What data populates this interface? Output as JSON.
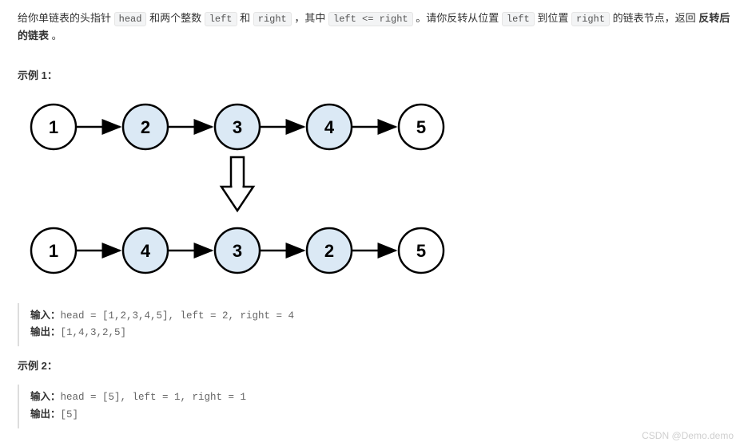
{
  "description": {
    "t1": "给你单链表的头指针 ",
    "c1": "head",
    "t2": " 和两个整数 ",
    "c2": "left",
    "t3": " 和 ",
    "c3": "right",
    "t4": " ，其中 ",
    "c4": "left <= right",
    "t5": " 。请你反转从位置 ",
    "c5": "left",
    "t6": " 到位置 ",
    "c6": "right",
    "t7": " 的链表节点，返回 ",
    "bold": "反转后的链表",
    "t8": " 。"
  },
  "example1": {
    "title": "示例 1：",
    "input_label": "输入：",
    "input_value": "head = [1,2,3,4,5], left = 2, right = 4",
    "output_label": "输出：",
    "output_value": "[1,4,3,2,5]"
  },
  "example2": {
    "title": "示例 2：",
    "input_label": "输入：",
    "input_value": "head = [5], left = 1, right = 1",
    "output_label": "输出：",
    "output_value": "[5]"
  },
  "diagram": {
    "top_nodes": [
      "1",
      "2",
      "3",
      "4",
      "5"
    ],
    "bottom_nodes": [
      "1",
      "4",
      "3",
      "2",
      "5"
    ],
    "highlight_color": "#dbe9f5",
    "plain_color": "#ffffff"
  },
  "watermark": "CSDN @Demo.demo",
  "chart_data": {
    "type": "table",
    "description": "Linked list reversal diagram",
    "before": [
      1,
      2,
      3,
      4,
      5
    ],
    "after": [
      1,
      4,
      3,
      2,
      5
    ],
    "highlighted_indices": [
      1,
      2,
      3
    ]
  }
}
